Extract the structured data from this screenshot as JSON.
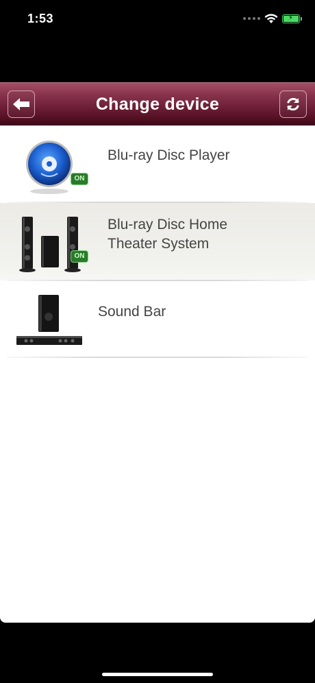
{
  "status_bar": {
    "time": "1:53"
  },
  "nav": {
    "title": "Change device"
  },
  "devices": [
    {
      "label_lines": [
        "Blu-ray Disc Player"
      ],
      "badge": "ON",
      "icon": "bluray-disc-icon",
      "selected": false
    },
    {
      "label_lines": [
        "Blu-ray Disc Home",
        "Theater System"
      ],
      "badge": "ON",
      "icon": "home-theater-icon",
      "selected": true
    },
    {
      "label_lines": [
        "Sound Bar"
      ],
      "badge": "",
      "icon": "sound-bar-icon",
      "selected": false
    }
  ],
  "colors": {
    "nav_top": "#a44d66",
    "nav_bottom": "#3a0716",
    "on_badge": "#2b7a2b"
  }
}
